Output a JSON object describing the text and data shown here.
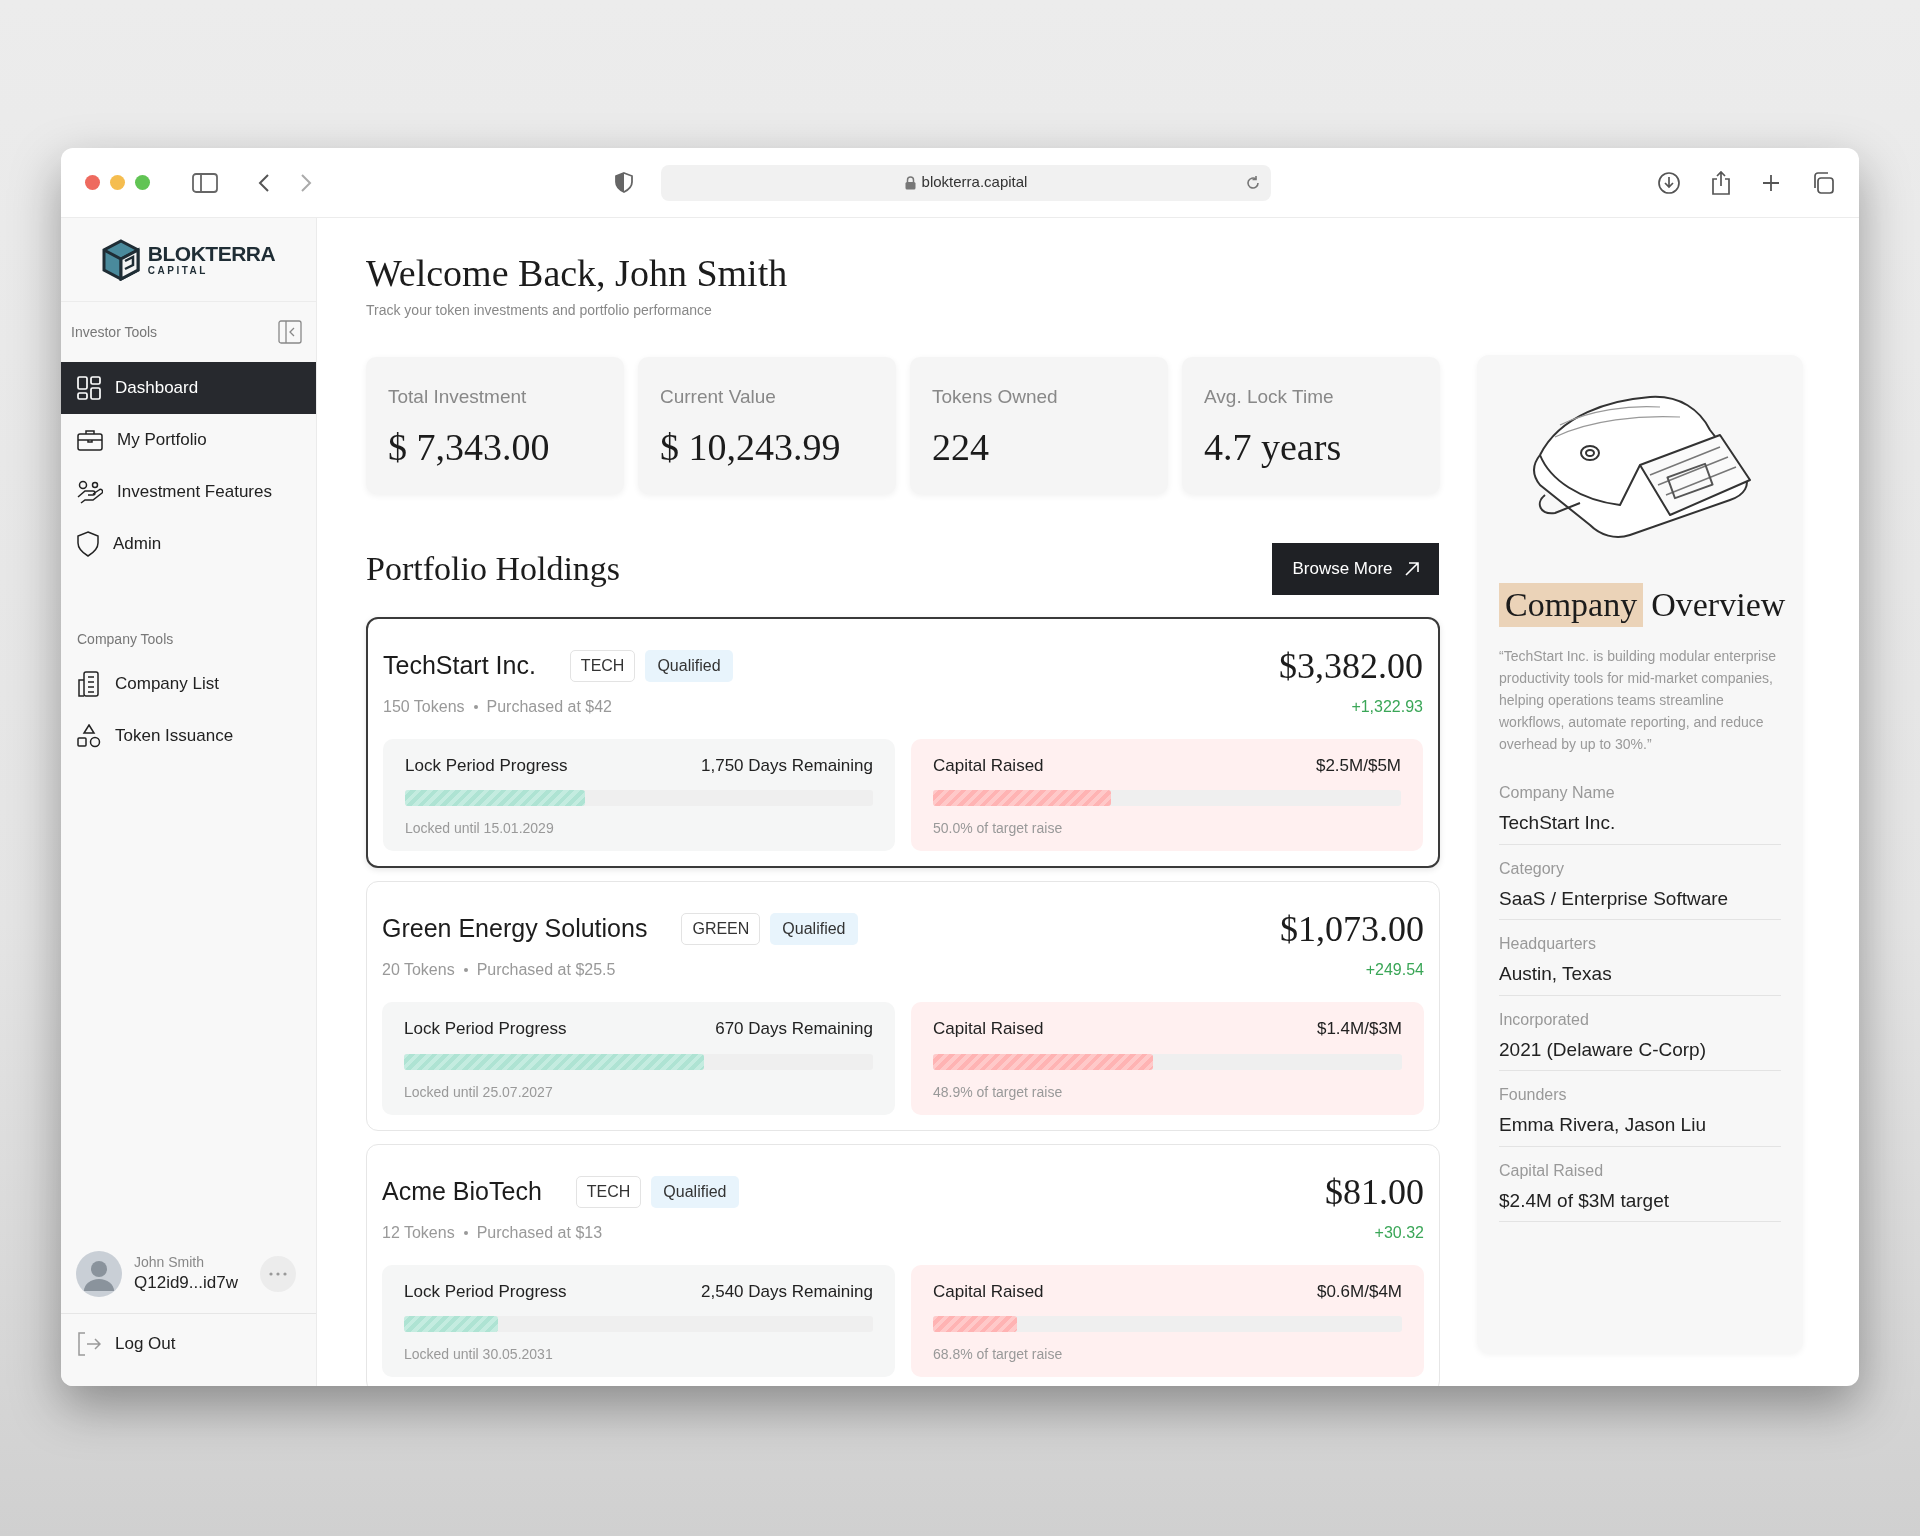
{
  "browser": {
    "url": "blokterra.capital"
  },
  "sidebar": {
    "logo": {
      "name": "BLOKTERRA",
      "subtitle": "CAPITAL"
    },
    "sections": [
      {
        "title": "Investor Tools",
        "items": [
          {
            "label": "Dashboard",
            "selected": true
          },
          {
            "label": "My Portfolio",
            "selected": false
          },
          {
            "label": "Investment Features",
            "selected": false
          },
          {
            "label": "Admin",
            "selected": false
          }
        ]
      },
      {
        "title": "Company Tools",
        "items": [
          {
            "label": "Company List",
            "selected": false
          },
          {
            "label": "Token Issuance",
            "selected": false
          }
        ]
      }
    ],
    "user": {
      "name": "John Smith",
      "wallet": "Q12id9...id7w"
    },
    "logout": "Log Out"
  },
  "header": {
    "title": "Welcome Back, John Smith",
    "subtitle": "Track your token investments and portfolio performance"
  },
  "stats": [
    {
      "label": "Total Investment",
      "value": "$ 7,343.00"
    },
    {
      "label": "Current Value",
      "value": "$ 10,243.99"
    },
    {
      "label": "Tokens Owned",
      "value": "224"
    },
    {
      "label": "Avg. Lock Time",
      "value": "4.7 years"
    }
  ],
  "holdings": {
    "title": "Portfolio Holdings",
    "browse_button": "Browse More",
    "cards": [
      {
        "name": "TechStart Inc.",
        "tag": "TECH",
        "badge": "Qualified",
        "tokens": "150 Tokens",
        "purchased": "Purchased at $42",
        "value": "$3,382.00",
        "change": "+1,322.93",
        "selected": true,
        "lock": {
          "label": "Lock Period Progress",
          "remaining": "1,750 Days Remaining",
          "level": 0.385,
          "note": "Locked until 15.01.2029"
        },
        "capital": {
          "label": "Capital Raised",
          "amount": "$2.5M/$5M",
          "level": 0.38,
          "note": "50.0% of target raise"
        }
      },
      {
        "name": "Green Energy Solutions",
        "tag": "GREEN",
        "badge": "Qualified",
        "tokens": "20 Tokens",
        "purchased": "Purchased at $25.5",
        "value": "$1,073.00",
        "change": "+249.54",
        "selected": false,
        "lock": {
          "label": "Lock Period Progress",
          "remaining": "670 Days Remaining",
          "level": 0.64,
          "note": "Locked until 25.07.2027"
        },
        "capital": {
          "label": "Capital Raised",
          "amount": "$1.4M/$3M",
          "level": 0.47,
          "note": "48.9% of target raise"
        }
      },
      {
        "name": "Acme BioTech",
        "tag": "TECH",
        "badge": "Qualified",
        "tokens": "12 Tokens",
        "purchased": "Purchased at $13",
        "value": "$81.00",
        "change": "+30.32",
        "selected": false,
        "lock": {
          "label": "Lock Period Progress",
          "remaining": "2,540 Days Remaining",
          "level": 0.2,
          "note": "Locked until 30.05.2031"
        },
        "capital": {
          "label": "Capital Raised",
          "amount": "$0.6M/$4M",
          "level": 0.18,
          "note": "68.8% of target raise"
        }
      }
    ]
  },
  "overview": {
    "title_highlight": "Company",
    "title_rest": "Overview",
    "quote": "“TechStart Inc. is building modular enterprise productivity tools for mid-market companies, helping operations teams streamline workflows, automate reporting, and reduce overhead by up to 30%.”",
    "fields": [
      {
        "label": "Company Name",
        "value": "TechStart Inc."
      },
      {
        "label": "Category",
        "value": "SaaS / Enterprise Software"
      },
      {
        "label": "Headquarters",
        "value": "Austin, Texas"
      },
      {
        "label": "Incorporated",
        "value": "2021 (Delaware C-Corp)"
      },
      {
        "label": "Founders",
        "value": "Emma Rivera, Jason Liu"
      },
      {
        "label": "Capital Raised",
        "value": "$2.4M of $3M target"
      }
    ]
  }
}
